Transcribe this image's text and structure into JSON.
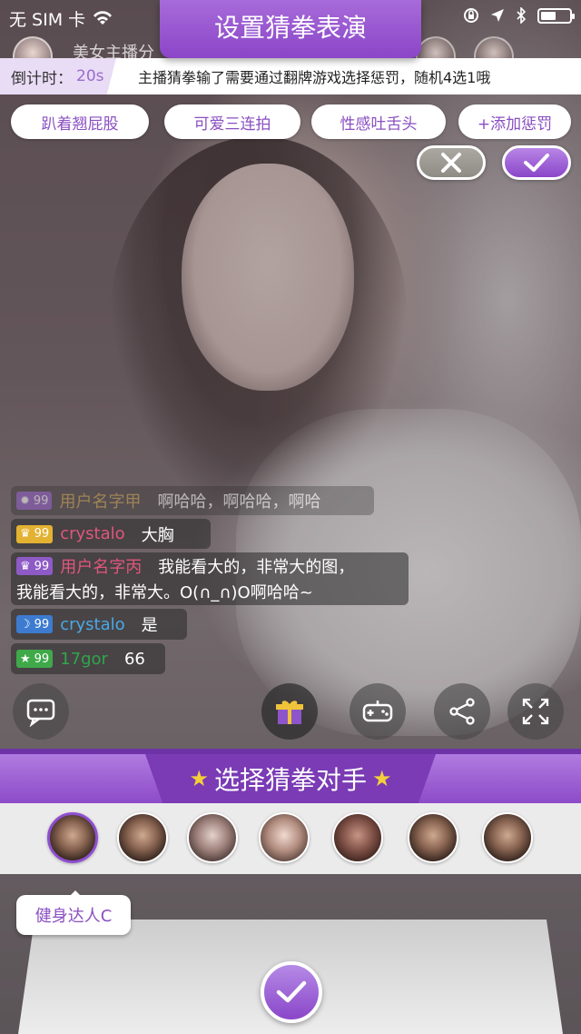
{
  "status_bar": {
    "carrier": "无 SIM 卡"
  },
  "host": {
    "name": "美女主播分"
  },
  "title": "设置猜拳表演",
  "countdown": {
    "label": "倒计时：",
    "seconds": "20s",
    "message": "主播猜拳输了需要通过翻牌游戏选择惩罚，随机4选1哦"
  },
  "penalties": [
    "趴着翘屁股",
    "可爱三连拍",
    "性感吐舌头",
    "+添加惩罚"
  ],
  "chat": [
    {
      "level": "99",
      "user": "用户名字甲",
      "text": "啊哈哈，啊哈哈，啊哈",
      "user_color": "#c9a24a",
      "badge": "b-purple"
    },
    {
      "level": "99",
      "user": "crystalo",
      "text": "大胸",
      "user_color": "#e0567e",
      "badge": "b-gold"
    },
    {
      "level": "99",
      "user": "用户名字丙",
      "text": "我能看大的，非常大的图，",
      "text2": "我能看大的，非常大。O(∩_∩)O啊哈哈~",
      "user_color": "#e0567e",
      "badge": "b-purple"
    },
    {
      "level": "99",
      "user": "crystalo",
      "text": "是",
      "user_color": "#4aa8e6",
      "badge": "b-blue"
    },
    {
      "level": "99",
      "user": "17gor",
      "text": "66",
      "user_color": "#2fa64a",
      "badge": "b-green"
    }
  ],
  "opponents": {
    "header": "选择猜拳对手",
    "selected_name": "健身达人C",
    "count": 7
  },
  "colors": {
    "accent": "#8a46c9",
    "accent_light": "#b885e6"
  }
}
